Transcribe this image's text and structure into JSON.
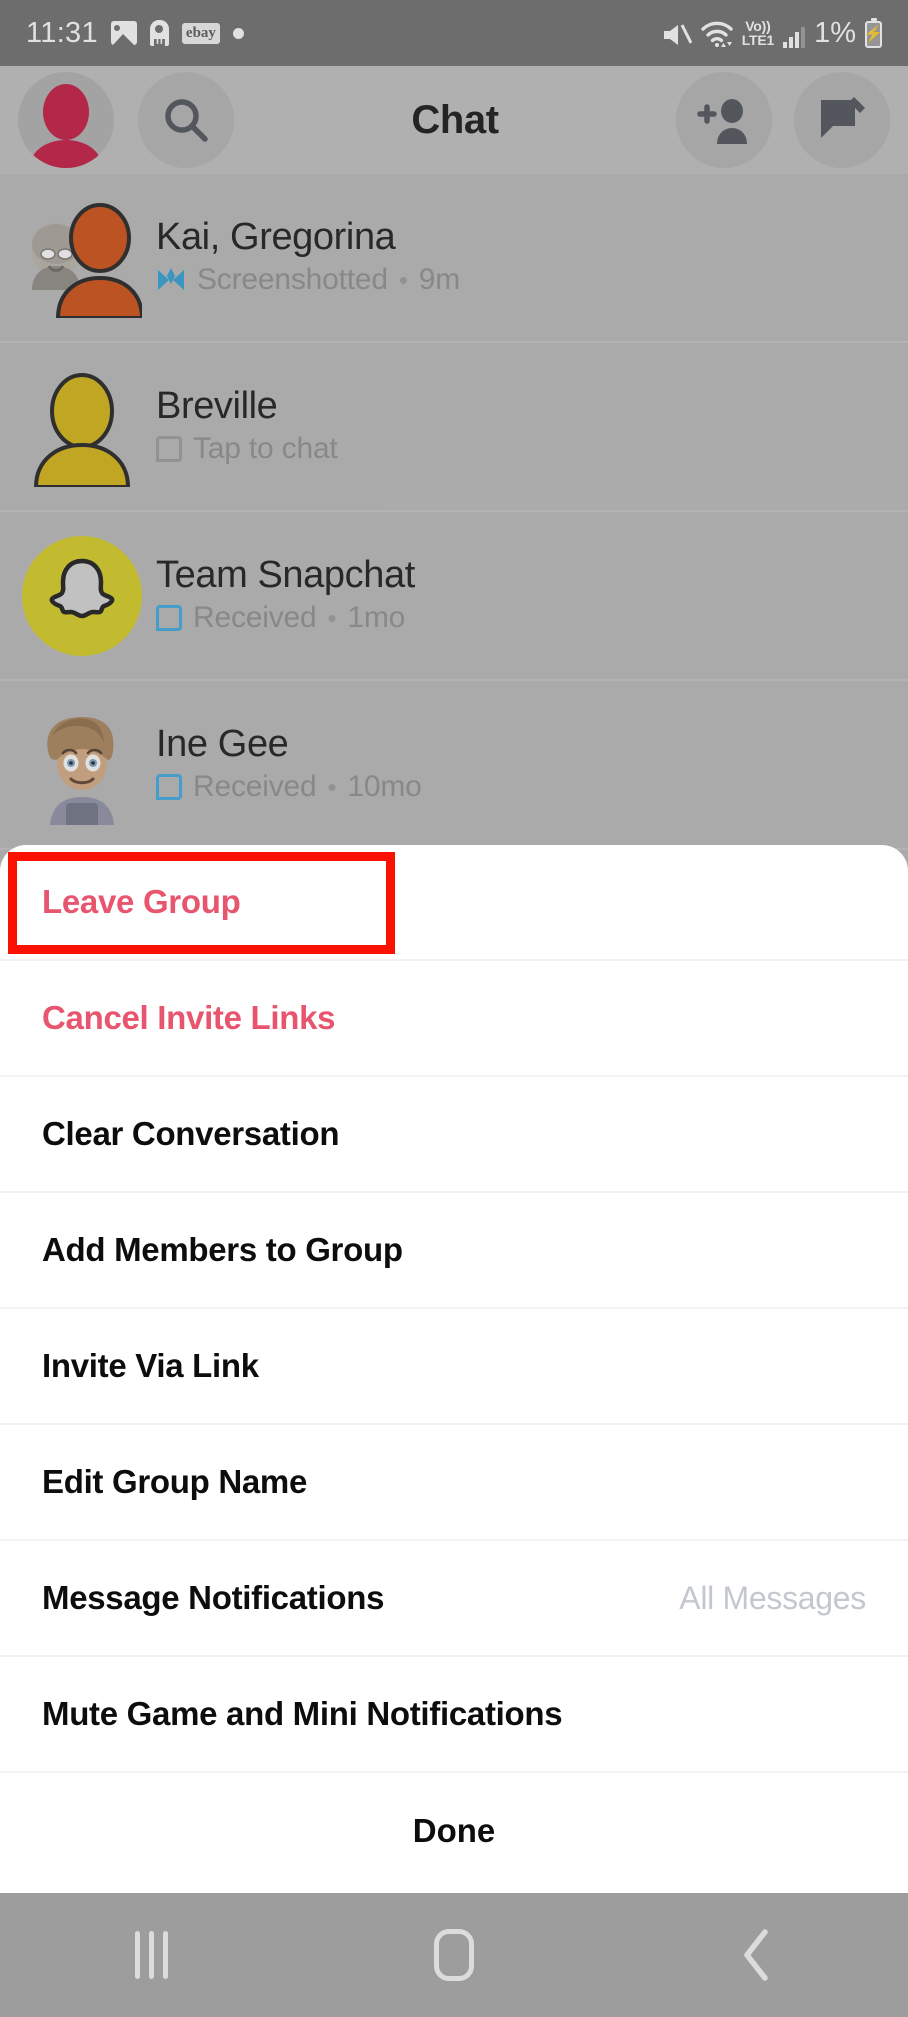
{
  "status_bar": {
    "time": "11:31",
    "battery_percent": "1%",
    "network_label_top": "Vo))",
    "network_label_bottom": "LTE1",
    "ebay_label": "ebay",
    "icons": [
      "gallery-icon",
      "robot-icon",
      "ebay-icon",
      "dot-icon",
      "mute-icon",
      "wifi-icon",
      "signal-bars-icon",
      "battery-charging-icon"
    ]
  },
  "header": {
    "title": "Chat",
    "avatar": "profile-avatar",
    "search": "search-icon",
    "add_friend": "add-friend-icon",
    "new_chat": "new-chat-icon"
  },
  "chat_list": [
    {
      "name": "Kai, Gregorina",
      "status": "Screenshotted",
      "time": "9m",
      "separator": "•",
      "icon": "screenshotted-icon",
      "avatar": "group-avatar"
    },
    {
      "name": "Breville",
      "status": "Tap to chat",
      "time": "",
      "separator": "",
      "icon": "chat-bubble-icon",
      "avatar": "yellow-bitmoji-avatar"
    },
    {
      "name": "Team Snapchat",
      "status": "Received",
      "time": "1mo",
      "separator": "•",
      "icon": "chat-bubble-blue-icon",
      "avatar": "snapchat-ghost-avatar"
    },
    {
      "name": "Ine Gee",
      "status": "Received",
      "time": "10mo",
      "separator": "•",
      "icon": "chat-bubble-blue-icon",
      "avatar": "bitmoji-avatar"
    }
  ],
  "action_sheet": {
    "items": [
      {
        "label": "Leave Group",
        "value": "",
        "style": "danger"
      },
      {
        "label": "Cancel Invite Links",
        "value": "",
        "style": "danger"
      },
      {
        "label": "Clear Conversation",
        "value": "",
        "style": "normal"
      },
      {
        "label": "Add Members to Group",
        "value": "",
        "style": "normal"
      },
      {
        "label": "Invite Via Link",
        "value": "",
        "style": "normal"
      },
      {
        "label": "Edit Group Name",
        "value": "",
        "style": "normal"
      },
      {
        "label": "Message Notifications",
        "value": "All Messages",
        "style": "normal"
      },
      {
        "label": "Mute Game and Mini Notifications",
        "value": "",
        "style": "normal"
      }
    ],
    "done_label": "Done"
  },
  "annotation": {
    "target": "Leave Group",
    "color": "#fb1100"
  },
  "nav_bar": {
    "recents": "recents-icon",
    "home": "home-icon",
    "back": "back-icon"
  },
  "colors": {
    "danger": "#e8556e",
    "snapchat_yellow": "#d9cf1b",
    "accent_blue": "#3aa8e0",
    "sheet_bg": "#ffffff",
    "app_bg": "#b9b9b9"
  }
}
